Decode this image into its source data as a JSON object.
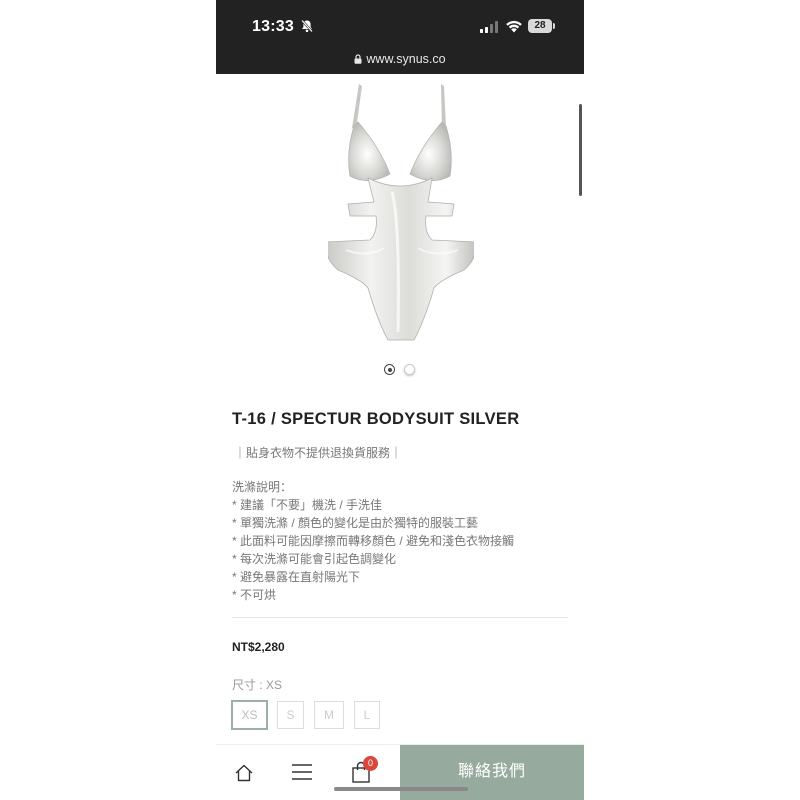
{
  "status_bar": {
    "time": "13:33",
    "battery": "28"
  },
  "browser": {
    "url": "www.synus.co"
  },
  "product": {
    "title": "T-16 / SPECTUR BODYSUIT SILVER",
    "notice": "｜貼身衣物不提供退換貨服務｜",
    "care_lines": [
      "洗滌說明：",
      "* 建議「不要」機洗 / 手洗佳",
      "* 單獨洗滌 / 顏色的變化是由於獨特的服裝工藝",
      "* 此面料可能因摩擦而轉移顏色 / 避免和淺色衣物接觸",
      "* 每次洗滌可能會引起色調變化",
      "* 避免暴露在直射陽光下",
      "* 不可烘"
    ],
    "price": "NT$2,280",
    "size_label": "尺寸 : XS",
    "sizes": [
      "XS",
      "S",
      "M",
      "L"
    ],
    "selected_size": "XS",
    "image_count": 2,
    "active_image": 1
  },
  "bottom_nav": {
    "cart_count": "0",
    "contact_label": "聯絡我們"
  },
  "colors": {
    "topbar": "#222222",
    "accent": "#97aa9e",
    "badge": "#d9473d"
  },
  "icons": [
    "bell-mute-icon",
    "signal-icon",
    "wifi-icon",
    "lock-icon",
    "home-icon",
    "menu-icon",
    "cart-icon"
  ]
}
